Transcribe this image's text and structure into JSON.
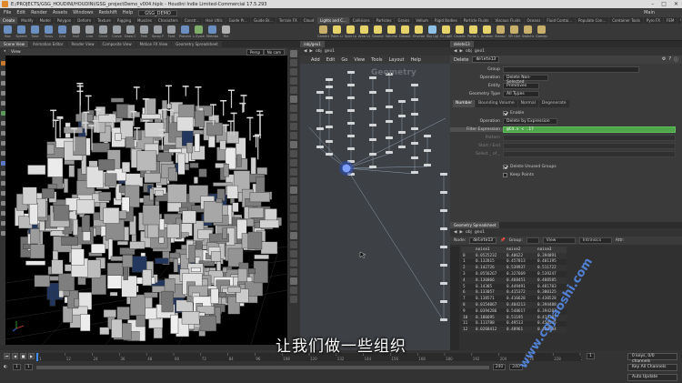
{
  "window": {
    "title": "E:/PROJECTS/GSG_HOUDINI/HOUDINI/GSG_projectDemo_v004.hiplc - Houdini Indie Limited-Commercial 17.5.293"
  },
  "menubar": {
    "items": [
      "File",
      "Edit",
      "Render",
      "Assets",
      "Windows",
      "Redshift",
      "Help"
    ],
    "desk": "GSG_DEMO",
    "desktop_right": "Main"
  },
  "shelf": {
    "left_tabs": [
      "Create",
      "Modify",
      "Model",
      "Polygon",
      "Deform",
      "Texture",
      "Rigging",
      "Muscles",
      "Characters",
      "Constr...",
      "Hair Utils",
      "Guide Pr...",
      "Guide Br...",
      "Terrain FX",
      "Cloud FX",
      "Volume",
      "Redshift"
    ],
    "right_tabs": [
      "Lights and C...",
      "Collisions",
      "Particles",
      "Grains",
      "Vellum",
      "Rigid Bodies",
      "Particle Fluids",
      "Viscous Fluids",
      "Oceans",
      "Fluid Contai...",
      "Populate Con...",
      "Container Tools",
      "Pyro FX",
      "FEM",
      "Wires",
      "Crowds",
      "Drive Simula..."
    ],
    "left_tools": [
      {
        "label": "Box",
        "color": "#6a8fc0"
      },
      {
        "label": "Sphere",
        "color": "#6a8fc0"
      },
      {
        "label": "Tube",
        "color": "#6a8fc0"
      },
      {
        "label": "Torus",
        "color": "#6a8fc0"
      },
      {
        "label": "Grid",
        "color": "#6a8fc0"
      },
      {
        "label": "Null",
        "color": "#9aa0a6"
      },
      {
        "label": "Line",
        "color": "#9aa0a6"
      },
      {
        "label": "Circle",
        "color": "#9aa0a6"
      },
      {
        "label": "Curve",
        "color": "#9aa0a6"
      },
      {
        "label": "Draw Curve",
        "color": "#9aa0a6"
      },
      {
        "label": "Path",
        "color": "#9aa0a6"
      },
      {
        "label": "Spray Paint",
        "color": "#9aa0a6"
      },
      {
        "label": "Font",
        "color": "#9aa0a6"
      },
      {
        "label": "Platonic Solids",
        "color": "#6a8fc0"
      },
      {
        "label": "L-System",
        "color": "#7fae6a"
      },
      {
        "label": "Metaball",
        "color": "#6a8fc0"
      },
      {
        "label": "File",
        "color": "#b0b0b0"
      }
    ],
    "right_tools": [
      {
        "label": "Camera",
        "color": "#c9b06a"
      },
      {
        "label": "Point Light",
        "color": "#e6d36a"
      },
      {
        "label": "Spot Light",
        "color": "#e6d36a"
      },
      {
        "label": "Area Light",
        "color": "#e6d36a"
      },
      {
        "label": "Geometry Light",
        "color": "#e6d36a"
      },
      {
        "label": "Volume Light",
        "color": "#e6d36a"
      },
      {
        "label": "Distant Light",
        "color": "#e6d36a"
      },
      {
        "label": "Environment Light",
        "color": "#e6d36a"
      },
      {
        "label": "Sky Light",
        "color": "#8fc0e6"
      },
      {
        "label": "GI Light",
        "color": "#e6d36a"
      },
      {
        "label": "Caustic Light",
        "color": "#e6d36a"
      },
      {
        "label": "Portal Light",
        "color": "#e6d36a"
      },
      {
        "label": "Ambient Light",
        "color": "#e6d36a"
      },
      {
        "label": "Stereo Camera",
        "color": "#c9b06a"
      },
      {
        "label": "VR Camera",
        "color": "#c9b06a"
      },
      {
        "label": "Switcher",
        "color": "#c9b06a"
      },
      {
        "label": "Gamepad Camera",
        "color": "#c9b06a"
      }
    ]
  },
  "left_pane": {
    "tabs": [
      "Scene View",
      "Animation Editor",
      "Render View",
      "Composite View",
      "Motion FX View",
      "Geometry Spreadsheet"
    ],
    "path": [
      "obj",
      "geo1"
    ],
    "view_label": "View",
    "persp": "Persp",
    "cam": "No cam"
  },
  "network": {
    "tabs": [
      "/obj/geo1"
    ],
    "path": [
      "obj",
      "geo1"
    ],
    "menu": [
      "Add",
      "Edit",
      "Go",
      "View",
      "Tools",
      "Layout",
      "Help"
    ],
    "watermark": "Geometry"
  },
  "params": {
    "tabs": [
      "delete13"
    ],
    "path": [
      "obj",
      "geo1"
    ],
    "node_type": "Delete",
    "node_name": "delete13",
    "group_label": "Group",
    "group_value": "",
    "operation_label": "Operation",
    "operation_value": "Delete Non-Selected",
    "entity_label": "Entity",
    "entity_value": "Primitives",
    "geotype_label": "Geometry Type",
    "geotype_value": "All Types",
    "subtabs": [
      "Number",
      "Bounding Volume",
      "Normal",
      "Degenerate"
    ],
    "enable_label": "Enable",
    "op2_label": "Operation",
    "op2_value": "Delete by Expression",
    "filter_label": "Filter Expression",
    "filter_value": "@Cd.x < .17",
    "pattern_label": "Pattern",
    "startend_label": "Start / End",
    "selectof_label": "Select _ of _",
    "delete_unused_label": "Delete Unused Groups",
    "keep_points_label": "Keep Points"
  },
  "spreadsheet": {
    "tabs": [
      "Geometry Spreadsheet"
    ],
    "path": [
      "obj",
      "geo1"
    ],
    "node_label": "Node:",
    "node_value": "delete13",
    "group_label": "Group:",
    "view_label": "View",
    "intrinsics_label": "Intrinsics",
    "attr_label": "Attr:",
    "columns": [
      "",
      "noise1",
      "noise2",
      "noise3"
    ],
    "rows": [
      [
        "0",
        "0.0525232",
        "0.40622",
        "0.394891"
      ],
      [
        "1",
        "0.132815",
        "0.457813",
        "0.401195"
      ],
      [
        "2",
        "0.142726",
        "0.539937",
        "0.511722"
      ],
      [
        "3",
        "0.0556267",
        "0.327669",
        "0.539247"
      ],
      [
        "4",
        "0.136066",
        "0.468451",
        "0.488585"
      ],
      [
        "5",
        "0.14385",
        "0.449491",
        "0.481783"
      ],
      [
        "6",
        "0.133057",
        "0.415372",
        "0.380125"
      ],
      [
        "7",
        "0.138571",
        "0.416628",
        "0.430528"
      ],
      [
        "8",
        "0.0154067",
        "0.404213",
        "0.394488"
      ],
      [
        "9",
        "0.0394286",
        "0.548617",
        "0.394287"
      ],
      [
        "10",
        "0.106695",
        "0.51195",
        "0.414787"
      ],
      [
        "11",
        "0.113788",
        "0.49513",
        "0.450545"
      ],
      [
        "12",
        "0.0268412",
        "0.48961",
        "0.438184"
      ]
    ]
  },
  "timeline": {
    "frame": "1",
    "start": "1",
    "end": "1",
    "range_end_a": "240",
    "range_end_b": "240",
    "keys_label": "0 keys, 0/0 channels",
    "key_all_label": "Key All Channels",
    "auto_update_label": "Auto Update",
    "ticks": [
      "1",
      "12",
      "24",
      "36",
      "48",
      "60",
      "72",
      "84",
      "96",
      "108",
      "120",
      "132",
      "144",
      "156",
      "168",
      "180",
      "192",
      "204",
      "216",
      "228",
      "240"
    ]
  },
  "subtitle": "让我们做一些组织",
  "watermark": "www.cgjiaoshi.com"
}
